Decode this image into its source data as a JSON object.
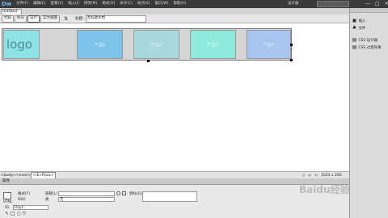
{
  "app": {
    "logo": "Dw",
    "menu": [
      "文件(F)",
      "编辑(E)",
      "查看(V)",
      "插入(I)",
      "修改(M)",
      "格式(O)",
      "命令(C)",
      "站点(S)",
      "窗口(W)",
      "帮助(H)"
    ],
    "workspace": "设计器",
    "window_controls": [
      "—",
      "□",
      "✕"
    ]
  },
  "document": {
    "tab_label": "Untitled-1*",
    "view_buttons": [
      "代码",
      "拆分",
      "设计",
      "实时视图"
    ],
    "title_label": "标题:",
    "title_value": "无标题文档"
  },
  "canvas": {
    "logo_text": "logo",
    "products": [
      "产品1",
      "产品2",
      "产品3",
      "产品4"
    ],
    "product_colors": [
      "#7ec3ea",
      "#a9d9de",
      "#8feadb",
      "#a6c6ef"
    ]
  },
  "status": {
    "tags": [
      "<body>",
      "<main>",
      "<div#box>"
    ],
    "right": "1022 x 200",
    "zoom": "100%"
  },
  "right_panel": {
    "items": [
      {
        "icon": "insert-icon",
        "glyph": "▣",
        "label": "插入"
      },
      {
        "icon": "files-icon",
        "glyph": "♣",
        "label": "文件"
      }
    ],
    "items2": [
      {
        "icon": "css-designer-icon",
        "glyph": "▤",
        "label": "CSS 设计器"
      },
      {
        "icon": "css-transitions-icon",
        "glyph": "▤",
        "label": "CSS 过渡效果"
      }
    ]
  },
  "properties": {
    "header": "属性",
    "html_label": "HTML",
    "format_label": "格式(F)",
    "format_value": "",
    "id_label": "ID(I)",
    "id_value": "",
    "link_label": "链接(L)",
    "link_value": "",
    "class_label": "类",
    "class_value": "无",
    "target_label": "目标(G)",
    "target_value": "",
    "title_label": "标题",
    "title_value": "",
    "image_id_label": "ID",
    "image_id_value": "Rsp1",
    "watermark": "Baidu经验"
  }
}
